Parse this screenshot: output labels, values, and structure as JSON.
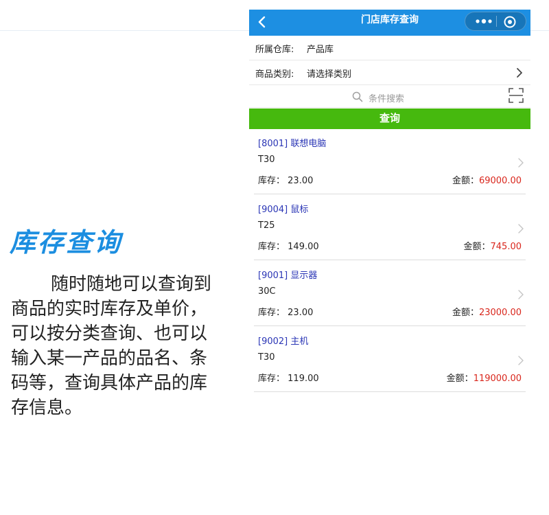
{
  "promo": {
    "title": "库存查询",
    "body": "随时随地可以查询到商品的实时库存及单价，可以按分类查询、也可以输入某一产品的品名、条码等，查询具体产品的库存信息。"
  },
  "navbar": {
    "title": "门店库存查询",
    "color": "#1d8fe2"
  },
  "form": {
    "warehouse_label": "所属仓库:",
    "warehouse_value": "产品库",
    "category_label": "商品类别:",
    "category_value": "请选择类别"
  },
  "search": {
    "placeholder": "条件搜索"
  },
  "query_button": {
    "label": "查询",
    "color": "#46b90e"
  },
  "products": [
    {
      "name": "[8001] 联想电脑",
      "model": "T30",
      "stock_label": "库存：",
      "stock": "23.00",
      "amount_label": "金额：",
      "amount": "69000.00"
    },
    {
      "name": "[9004] 鼠标",
      "model": "T25",
      "stock_label": "库存：",
      "stock": "149.00",
      "amount_label": "金额：",
      "amount": "745.00"
    },
    {
      "name": "[9001] 显示器",
      "model": "30C",
      "stock_label": "库存：",
      "stock": "23.00",
      "amount_label": "金额：",
      "amount": "23000.00"
    },
    {
      "name": "[9002] 主机",
      "model": "T30",
      "stock_label": "库存：",
      "stock": "119.00",
      "amount_label": "金额：",
      "amount": "119000.00"
    }
  ],
  "colors": {
    "product_name": "#2a35b5",
    "amount": "#d9261c",
    "promo_title": "#1c8ee0"
  }
}
